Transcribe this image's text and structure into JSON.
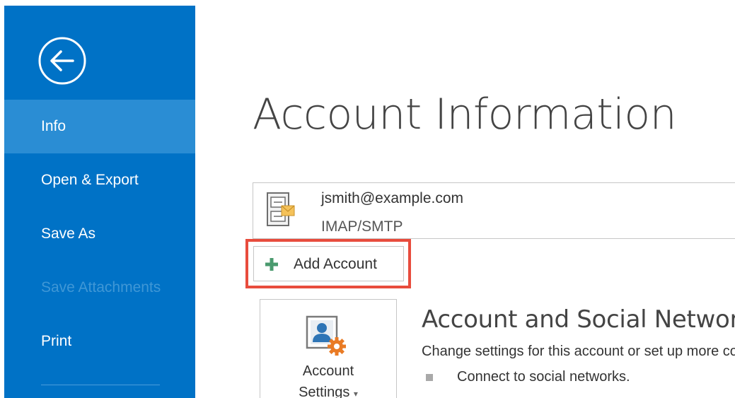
{
  "sidebar": {
    "back_icon": "back-arrow-circle-icon",
    "items": [
      {
        "label": "Info",
        "state": "active"
      },
      {
        "label": "Open & Export",
        "state": "normal"
      },
      {
        "label": "Save As",
        "state": "normal"
      },
      {
        "label": "Save Attachments",
        "state": "disabled"
      },
      {
        "label": "Print",
        "state": "normal"
      }
    ],
    "background_color": "#0072c6",
    "active_color": "#2a8dd4"
  },
  "main": {
    "title": "Account Information",
    "account": {
      "email": "jsmith@example.com",
      "type": "IMAP/SMTP",
      "icon": "mail-account-icon"
    },
    "add_account": {
      "label": "Add Account",
      "icon": "plus-icon",
      "highlight_color": "#e84c3d"
    },
    "account_settings": {
      "label_line1": "Account",
      "label_line2": "Settings",
      "caret": "▾",
      "icon": "account-settings-icon"
    },
    "section": {
      "title": "Account and Social Network Settings",
      "description": "Change settings for this account or set up more connections.",
      "bullets": [
        "Connect to social networks."
      ]
    }
  }
}
